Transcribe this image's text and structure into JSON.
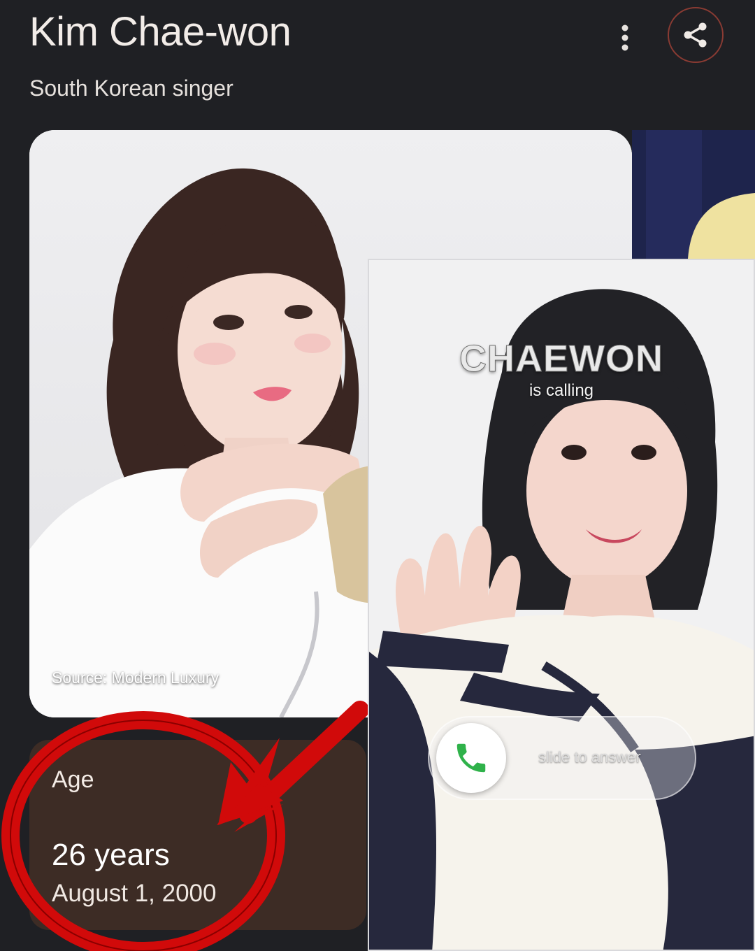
{
  "header": {
    "title": "Kim Chae-won",
    "subtitle": "South Korean singer"
  },
  "icons": {
    "more": "more-vert-icon",
    "share": "share-icon",
    "answer": "phone-icon"
  },
  "image_card": {
    "source_caption": "Source: Modern Luxury"
  },
  "age_card": {
    "label": "Age",
    "value": "26 years",
    "date": "August 1, 2000"
  },
  "call_overlay": {
    "caller": "CHAEWON",
    "status": "is calling",
    "slide_hint": "slide to answer"
  },
  "colors": {
    "background": "#1f2024",
    "age_card": "#3d2c25",
    "annotation_red": "#d10a0a",
    "answer_green": "#2fb24a"
  }
}
